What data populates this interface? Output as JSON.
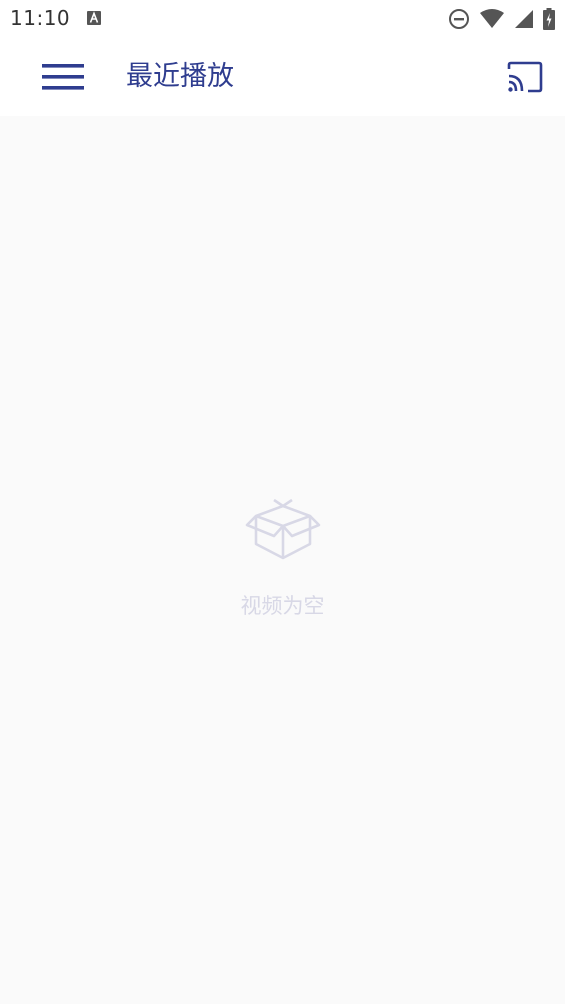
{
  "status_bar": {
    "time": "11:10",
    "icons": [
      "a-notification-icon",
      "do-not-disturb-icon",
      "wifi-icon",
      "cell-signal-icon",
      "battery-charging-icon"
    ]
  },
  "app_bar": {
    "title": "最近播放",
    "menu_icon": "hamburger-menu-icon",
    "cast_icon": "cast-icon",
    "accent_color": "#2f3d8f"
  },
  "empty_state": {
    "icon": "empty-box-icon",
    "message": "视频为空",
    "color": "#d8d8e6"
  }
}
